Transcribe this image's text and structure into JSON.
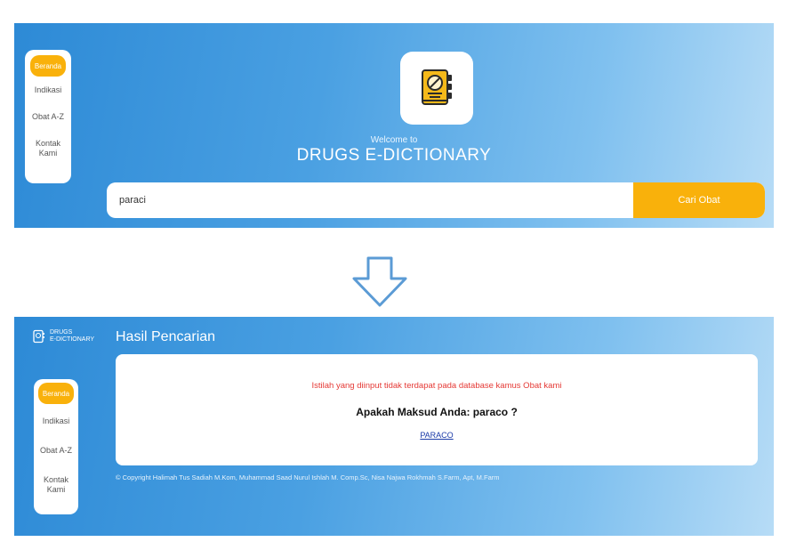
{
  "search_page": {
    "nav": {
      "items": [
        {
          "label": "Beranda",
          "active": true
        },
        {
          "label": "Indikasi"
        },
        {
          "label": "Obat A-Z"
        },
        {
          "label": "Kontak\nKami"
        }
      ]
    },
    "welcome_text": "Welcome to",
    "title": "DRUGS E-DICTIONARY",
    "search": {
      "value": "paraci",
      "button_label": "Cari Obat"
    }
  },
  "results_page": {
    "brand": {
      "line1": "DRUGS",
      "line2": "E-DICTIONARY"
    },
    "heading": "Hasil Pencarian",
    "nav": {
      "items": [
        {
          "label": "Beranda",
          "active": true
        },
        {
          "label": "Indikasi"
        },
        {
          "label": "Obat A-Z"
        },
        {
          "label": "Kontak\nKami"
        }
      ]
    },
    "error_message": "Istilah yang diinput tidak terdapat pada database kamus Obat kami",
    "suggestion_text": "Apakah Maksud Anda: paraco ?",
    "suggestion_link": "PARACO",
    "copyright": "© Copyright Halimah Tus Sadiah M.Kom, Muhammad Saad Nurul Ishlah M. Comp.Sc, Nisa Najwa Rokhmah S.Farm, Apt, M.Farm"
  },
  "colors": {
    "accent": "#f9b10b",
    "gradient_start": "#2d8ad6",
    "gradient_end": "#b7dcf6",
    "error": "#e53935",
    "link": "#1a3aa8"
  },
  "icons": [
    "book-pill-logo-icon",
    "down-arrow-icon"
  ]
}
